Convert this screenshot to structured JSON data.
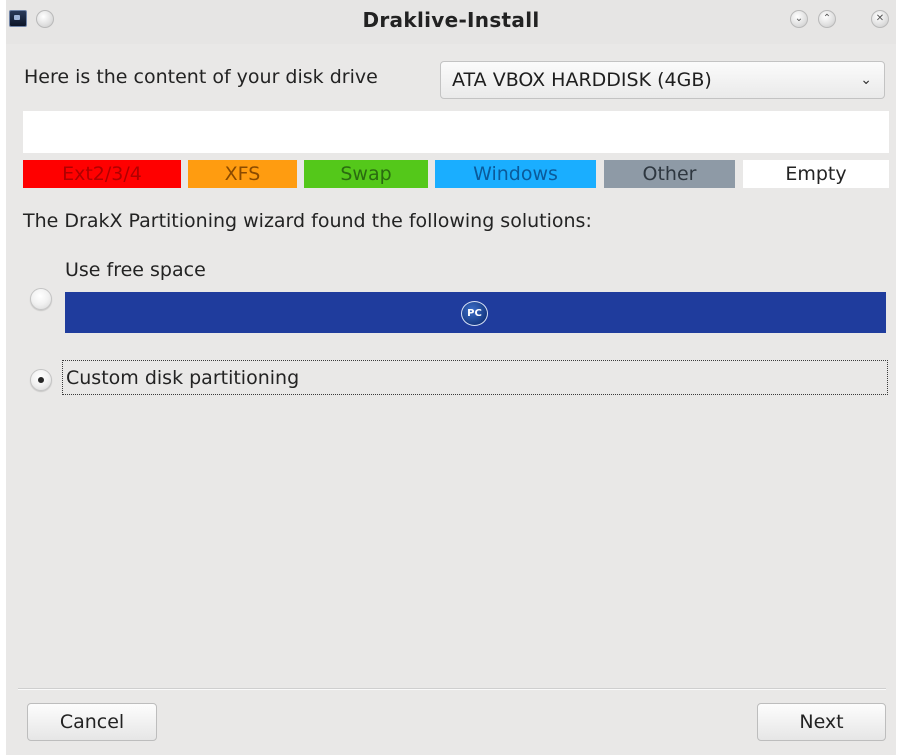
{
  "window": {
    "title": "Draklive-Install",
    "controls": {
      "minimize_icon": "chevron-down-icon",
      "maximize_icon": "chevron-up-icon",
      "close_icon": "close-icon"
    }
  },
  "disk": {
    "label": "Here is the content of your disk drive",
    "selected": "ATA VBOX HARDDISK (4GB)"
  },
  "legend": [
    {
      "label": "Ext2/3/4",
      "color": "#ff0000",
      "text_color": "#b00000"
    },
    {
      "label": "XFS",
      "color": "#ff9c10",
      "text_color": "#8a4a00"
    },
    {
      "label": "Swap",
      "color": "#54c81a",
      "text_color": "#2a6b10"
    },
    {
      "label": "Windows",
      "color": "#1aaeff",
      "text_color": "#0b5a9a"
    },
    {
      "label": "Other",
      "color": "#8e9aa6",
      "text_color": "#2e3740"
    },
    {
      "label": "Empty",
      "color": "#ffffff",
      "text_color": "#232323"
    }
  ],
  "solutions": {
    "heading": "The DrakX Partitioning wizard found the following solutions:",
    "options": [
      {
        "label": "Use free space",
        "checked": false,
        "bar_color": "#1f3c9d",
        "logo_text": "PC"
      },
      {
        "label": "Custom disk partitioning",
        "checked": true
      }
    ]
  },
  "buttons": {
    "cancel": "Cancel",
    "next": "Next"
  }
}
